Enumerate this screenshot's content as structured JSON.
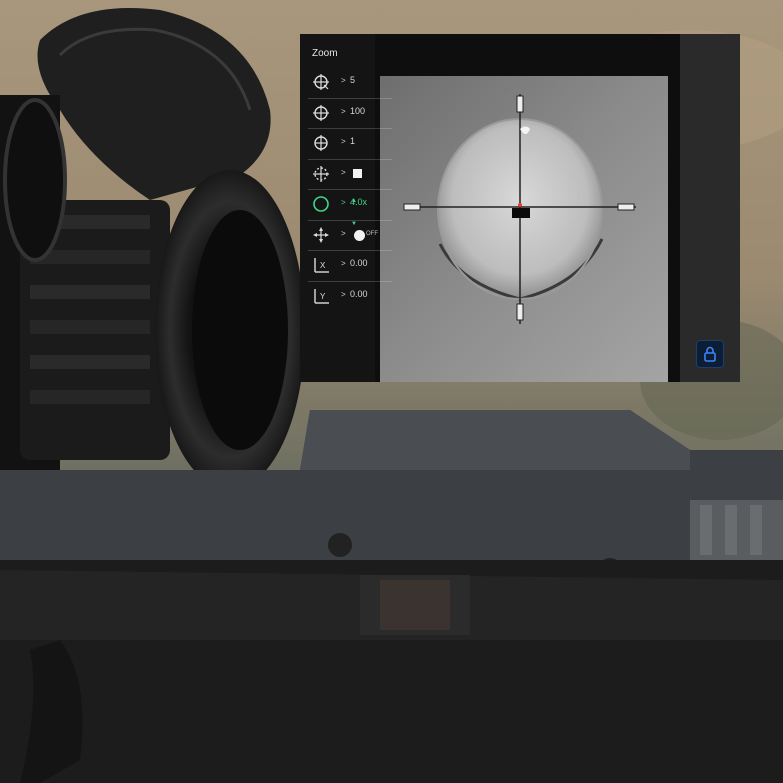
{
  "menu": {
    "title": "Zoom",
    "items": [
      {
        "icon": "zoom-step-icon",
        "value": "5"
      },
      {
        "icon": "distance-icon",
        "value": "100"
      },
      {
        "icon": "reticle-type-icon",
        "value": "1"
      },
      {
        "icon": "reticle-color-icon",
        "value": ""
      },
      {
        "icon": "zoom-icon",
        "value": "4.0x",
        "active": true
      },
      {
        "icon": "brightness-icon",
        "value": ""
      },
      {
        "icon": "x-offset-icon",
        "value": "0.00"
      },
      {
        "icon": "y-offset-icon",
        "value": "0.00"
      }
    ],
    "chevron": ">",
    "brightness_label": "OFF"
  },
  "colors": {
    "accent": "#3fd68a",
    "lock_button": "#1d5fbf"
  },
  "lock_button_icon": "lock-icon"
}
